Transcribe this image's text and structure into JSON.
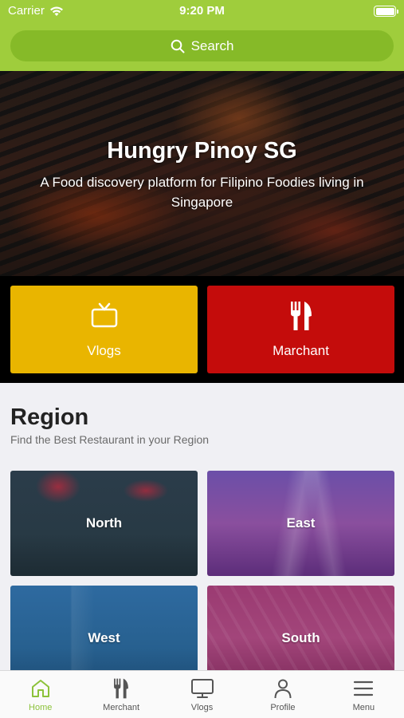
{
  "status_bar": {
    "carrier": "Carrier",
    "time": "9:20 PM"
  },
  "search": {
    "label": "Search"
  },
  "hero": {
    "title": "Hungry Pinoy SG",
    "subtitle": "A Food discovery platform for Filipino Foodies living in Singapore"
  },
  "quick_links": [
    {
      "label": "Vlogs",
      "icon": "tv-icon",
      "color": "#e9b500"
    },
    {
      "label": "Marchant",
      "icon": "fork-knife-icon",
      "color": "#c40c0b"
    }
  ],
  "region": {
    "title": "Region",
    "subtitle": "Find the Best Restaurant in your Region",
    "cards": [
      {
        "label": "North"
      },
      {
        "label": "East"
      },
      {
        "label": "West"
      },
      {
        "label": "South"
      }
    ]
  },
  "tab_bar": {
    "active_color": "#8cc23a",
    "items": [
      {
        "label": "Home",
        "icon": "home-icon",
        "active": true
      },
      {
        "label": "Merchant",
        "icon": "fork-knife-icon",
        "active": false
      },
      {
        "label": "Vlogs",
        "icon": "monitor-icon",
        "active": false
      },
      {
        "label": "Profile",
        "icon": "person-icon",
        "active": false
      },
      {
        "label": "Menu",
        "icon": "hamburger-icon",
        "active": false
      }
    ]
  },
  "colors": {
    "brand_green": "#9fcd3c",
    "search_field": "#86ba28"
  }
}
